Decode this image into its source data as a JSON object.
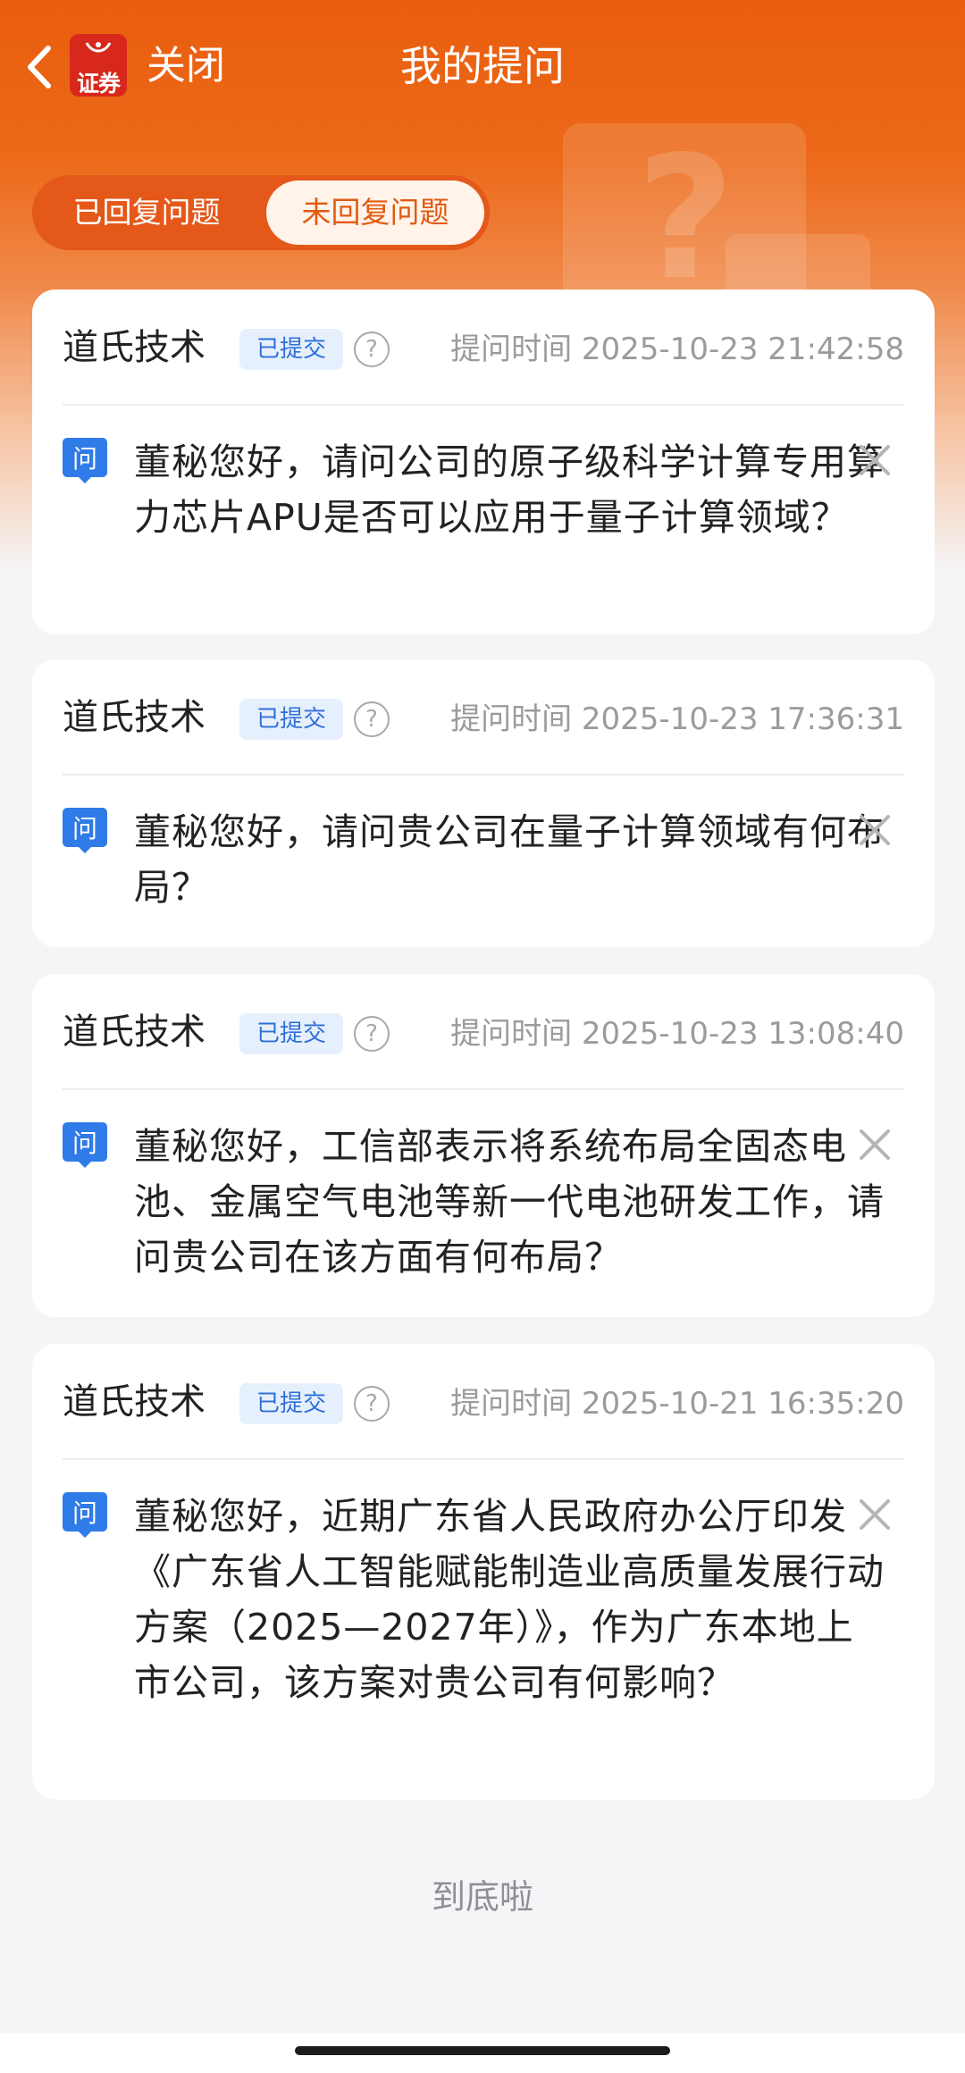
{
  "header": {
    "close_label": "关闭",
    "title": "我的提问",
    "logo_text": "证券"
  },
  "tabs": [
    {
      "label": "已回复问题",
      "active": false
    },
    {
      "label": "未回复问题",
      "active": true
    }
  ],
  "questions": [
    {
      "company": "道氏技术",
      "status": "已提交",
      "time_prefix": "提问时间",
      "time": "2025-10-23 21:42:58",
      "text": "董秘您好，请问公司的原子级科学计算专用算力芯片APU是否可以应用于量子计算领域？"
    },
    {
      "company": "道氏技术",
      "status": "已提交",
      "time_prefix": "提问时间",
      "time": "2025-10-23 17:36:31",
      "text": "董秘您好，请问贵公司在量子计算领域有何布局？"
    },
    {
      "company": "道氏技术",
      "status": "已提交",
      "time_prefix": "提问时间",
      "time": "2025-10-23 13:08:40",
      "text": "董秘您好，工信部表示将系统布局全固态电池、金属空气电池等新一代电池研发工作，请问贵公司在该方面有何布局？"
    },
    {
      "company": "道氏技术",
      "status": "已提交",
      "time_prefix": "提问时间",
      "time": "2025-10-21 16:35:20",
      "text": "董秘您好，近期广东省人民政府办公厅印发《广东省人工智能赋能制造业高质量发展行动方案（2025—2027年）》，作为广东本地上市公司，该方案对贵公司有何影响？"
    }
  ],
  "question_icon_char": "问",
  "footer": "到底啦",
  "colors": {
    "brand_orange": "#e95d0e",
    "badge_blue": "#2f6fd9",
    "question_icon_blue": "#2f7be8"
  }
}
